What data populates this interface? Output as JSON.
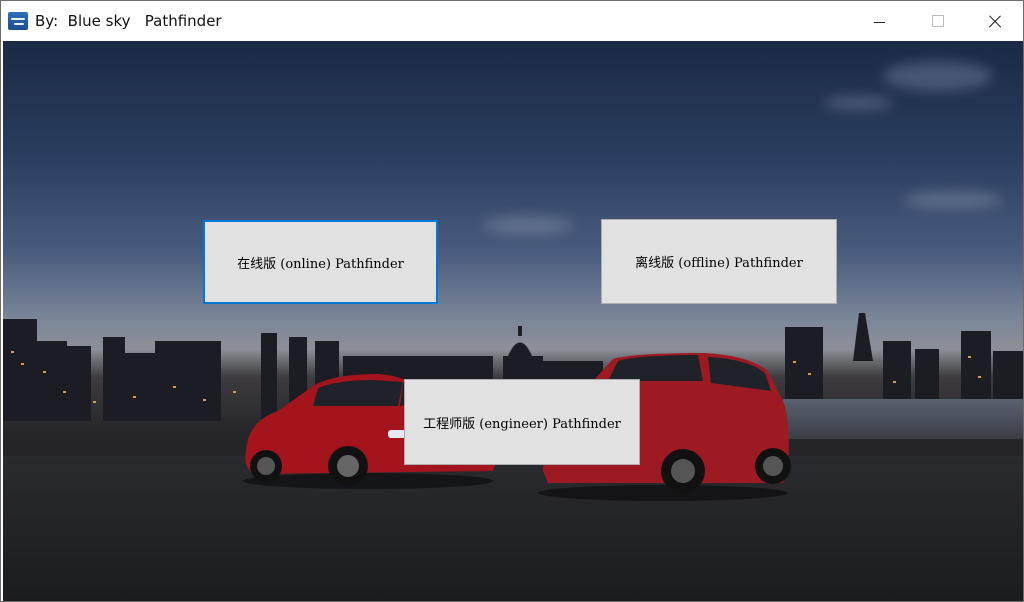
{
  "window": {
    "title": "By:  Blue sky   Pathfinder",
    "icon": "app-logo-icon",
    "controls": {
      "minimize": "minimize-icon",
      "maximize": "maximize-icon",
      "close": "close-icon"
    }
  },
  "buttons": {
    "online": "在线版 (online) Pathfinder",
    "offline": "离线版 (offline) Pathfinder",
    "engineer": "工程师版 (engineer) Pathfinder"
  },
  "colors": {
    "focus_border": "#0078d7",
    "button_face": "#e1e1e1",
    "car_red": "#a3141c"
  }
}
